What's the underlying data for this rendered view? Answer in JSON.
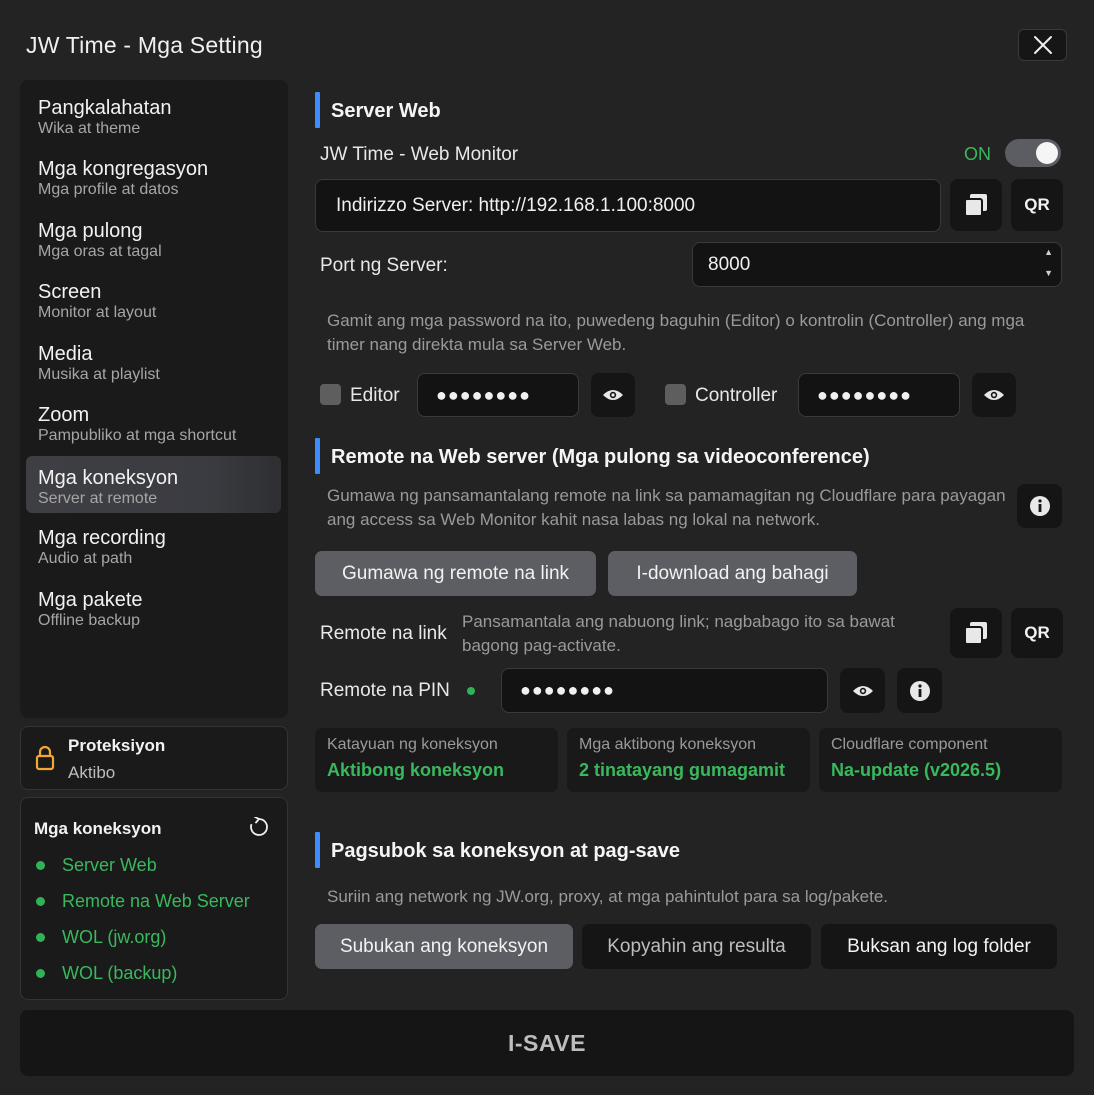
{
  "window": {
    "title": "JW Time - Mga Setting"
  },
  "sidebar": {
    "items": [
      {
        "label": "Pangkalahatan",
        "sub": "Wika at theme"
      },
      {
        "label": "Mga kongregasyon",
        "sub": "Mga profile at datos"
      },
      {
        "label": "Mga pulong",
        "sub": "Mga oras at tagal"
      },
      {
        "label": "Screen",
        "sub": "Monitor at layout"
      },
      {
        "label": "Media",
        "sub": "Musika at playlist"
      },
      {
        "label": "Zoom",
        "sub": "Pampubliko at mga shortcut"
      },
      {
        "label": "Mga koneksyon",
        "sub": "Server at remote"
      },
      {
        "label": "Mga recording",
        "sub": "Audio at path"
      },
      {
        "label": "Mga pakete",
        "sub": "Offline backup"
      }
    ],
    "active_index": 6
  },
  "protection": {
    "title": "Proteksiyon",
    "status": "Aktibo"
  },
  "connections_panel": {
    "title": "Mga koneksyon",
    "items": [
      "Server Web",
      "Remote na Web Server",
      "WOL (jw.org)",
      "WOL (backup)"
    ]
  },
  "server_web": {
    "title": "Server Web",
    "monitor_label": "JW Time - Web Monitor",
    "toggle_state": "ON",
    "address": "Indirizzo Server: http://192.168.1.100:8000",
    "qr_label": "QR",
    "port_label": "Port ng Server:",
    "port_value": "8000",
    "password_desc": "Gamit ang mga password na ito, puwedeng baguhin (Editor) o kontrolin (Controller) ang mga timer nang direkta mula sa Server Web.",
    "editor_label": "Editor",
    "editor_password": "●●●●●●●●",
    "controller_label": "Controller",
    "controller_password": "●●●●●●●●"
  },
  "remote": {
    "title": "Remote na Web server (Mga pulong sa videoconference)",
    "desc": "Gumawa ng pansamantalang remote na link sa pamamagitan ng Cloudflare para payagan ang access sa Web Monitor kahit nasa labas ng lokal na network.",
    "create_button": "Gumawa ng remote na link",
    "download_button": "I-download ang bahagi",
    "link_label": "Remote na link",
    "link_desc": "Pansamantala ang nabuong link; nagbabago ito sa bawat bagong pag-activate.",
    "qr_label": "QR",
    "pin_label": "Remote na PIN",
    "pin_value": "●●●●●●●●",
    "stats": [
      {
        "label": "Katayuan ng koneksyon",
        "value": "Aktibong koneksyon"
      },
      {
        "label": "Mga aktibong koneksyon",
        "value": "2 tinatayang gumagamit"
      },
      {
        "label": "Cloudflare component",
        "value": "Na-update (v2026.5)"
      }
    ]
  },
  "test": {
    "title": "Pagsubok sa koneksyon at pag-save",
    "desc": "Suriin ang network ng JW.org, proxy, at mga pahintulot para sa log/pakete.",
    "test_button": "Subukan ang koneksyon",
    "copy_button": "Kopyahin ang resulta",
    "open_button": "Buksan ang log folder"
  },
  "save_button": "I-SAVE",
  "colors": {
    "accent": "#3f8cff",
    "success": "#39b85e",
    "background": "#232323"
  }
}
